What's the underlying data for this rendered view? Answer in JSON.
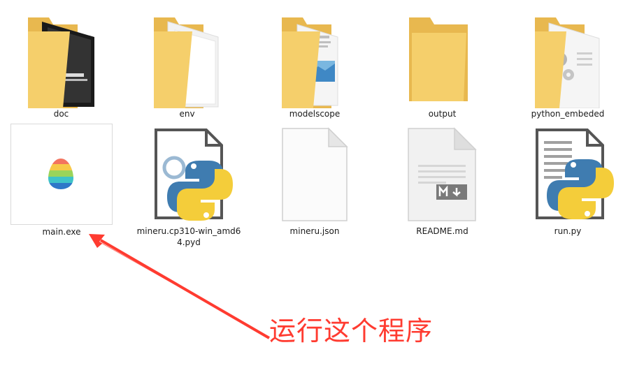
{
  "files": [
    {
      "name": "doc",
      "type": "folder"
    },
    {
      "name": "env",
      "type": "folder"
    },
    {
      "name": "modelscope",
      "type": "folder"
    },
    {
      "name": "output",
      "type": "folder"
    },
    {
      "name": "python_embeded",
      "type": "folder"
    },
    {
      "name": "main.exe",
      "type": "exe",
      "icon": "mineru-egg-icon"
    },
    {
      "name": "mineru.cp310-win_amd6\n4.pyd",
      "type": "pyd",
      "icon": "python-gear-icon"
    },
    {
      "name": "mineru.json",
      "type": "json",
      "icon": "blank-file-icon"
    },
    {
      "name": "README.md",
      "type": "md",
      "icon": "markdown-file-icon"
    },
    {
      "name": "run.py",
      "type": "py",
      "icon": "python-file-icon"
    }
  ],
  "annotation": {
    "text": "运行这个程序",
    "color": "#ff3b30"
  }
}
